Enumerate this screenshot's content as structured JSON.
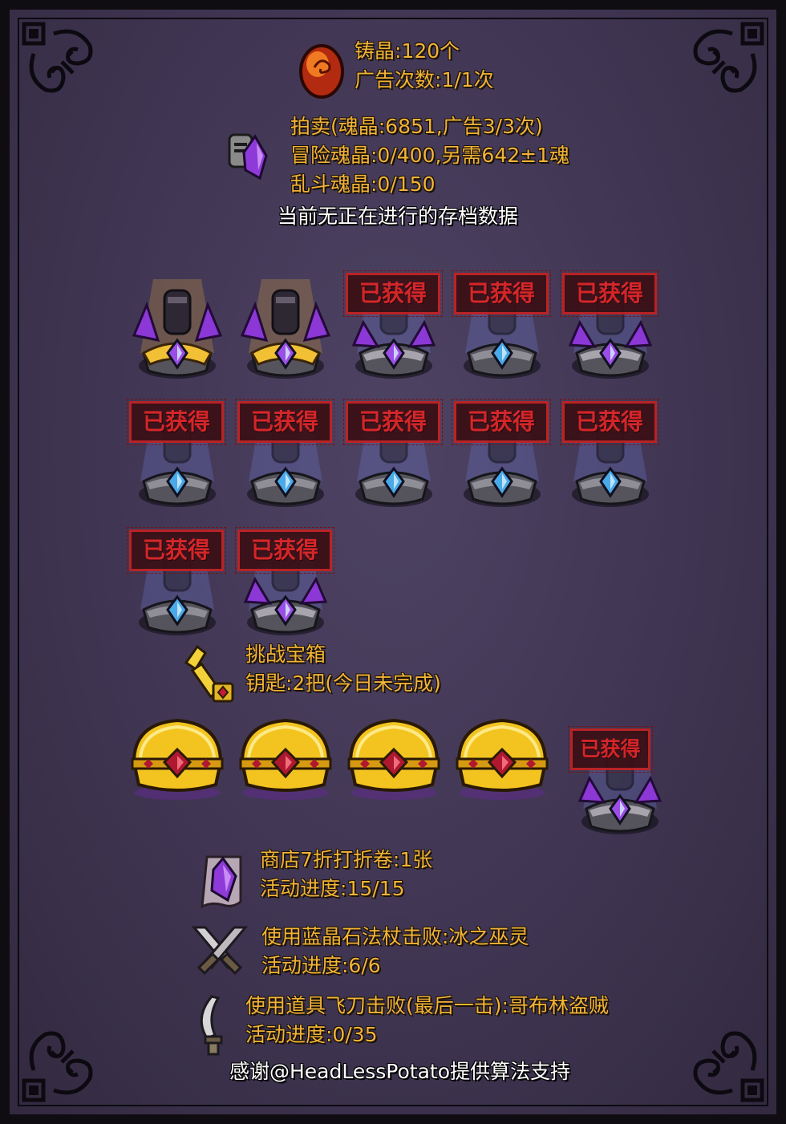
{
  "casting": {
    "count_text": "铸晶:120个",
    "ads_text": "广告次数:1/1次"
  },
  "auction": {
    "line1": "拍卖(魂晶:6851,广告3/3次)",
    "line2": "冒险魂晶:0/400,另需642±1魂",
    "line3": "乱斗魂晶:0/150"
  },
  "save_status": "当前无正在进行的存档数据",
  "obtained_label": "已获得",
  "rewards": {
    "row1": [
      {
        "item": "dark-knight",
        "obtained": false,
        "base": "gold"
      },
      {
        "item": "ring",
        "obtained": false,
        "base": "gold"
      },
      {
        "item": "staff",
        "obtained": true,
        "base": "purple"
      },
      {
        "item": "blade",
        "obtained": true,
        "base": "silver"
      },
      {
        "item": "red-knight",
        "obtained": true,
        "base": "purple"
      }
    ],
    "row2": [
      {
        "item": "mace",
        "obtained": true,
        "base": "silver"
      },
      {
        "item": "red-warrior",
        "obtained": true,
        "base": "silver"
      },
      {
        "item": "golden-axe",
        "obtained": true,
        "base": "silver"
      },
      {
        "item": "goblin",
        "obtained": true,
        "base": "silver"
      },
      {
        "item": "golden-beast",
        "obtained": true,
        "base": "silver"
      }
    ],
    "row3": [
      {
        "item": "golden-helm",
        "obtained": true,
        "base": "silver"
      },
      {
        "item": "shadow-beast",
        "obtained": true,
        "base": "purple"
      }
    ]
  },
  "challenge": {
    "title": "挑战宝箱",
    "keys_text": "钥匙:2把(今日未完成)"
  },
  "chests": [
    {
      "obtained": false
    },
    {
      "obtained": false
    },
    {
      "obtained": false
    },
    {
      "obtained": false
    },
    {
      "obtained": true
    }
  ],
  "shop": {
    "coupon_text": "商店7折打折卷:1张",
    "progress_text": "活动进度:15/15"
  },
  "staff_quest": {
    "title": "使用蓝晶石法杖击败:冰之巫灵",
    "progress_text": "活动进度:6/6"
  },
  "knife_quest": {
    "title": "使用道具飞刀击败(最后一击):哥布林盗贼",
    "progress_text": "活动进度:0/35"
  },
  "credits": "感谢@HeadLessPotato提供算法支持",
  "colors": {
    "accent_text": "#f2b437",
    "stamp_red": "#c42121",
    "background": "#3f3552"
  }
}
